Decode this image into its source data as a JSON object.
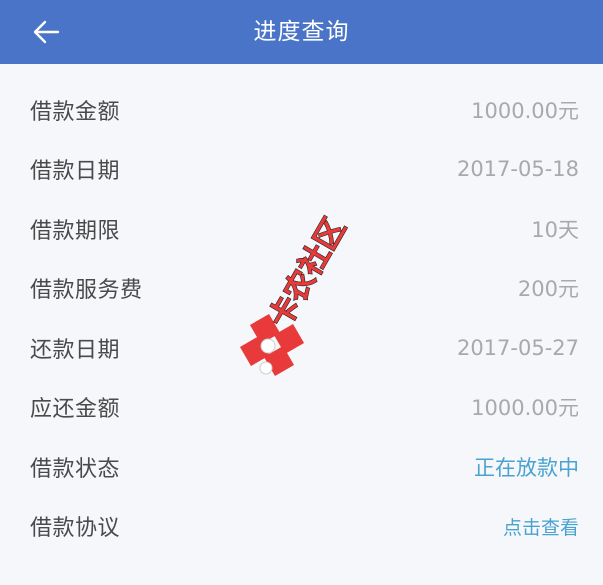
{
  "header": {
    "title": "进度查询",
    "back_icon": "arrow-left-icon"
  },
  "rows": [
    {
      "label": "借款金额",
      "value": "1000.00元"
    },
    {
      "label": "借款日期",
      "value": "2017-05-18"
    },
    {
      "label": "借款期限",
      "value": "10天"
    },
    {
      "label": "借款服务费",
      "value": "200元"
    },
    {
      "label": "还款日期",
      "value": "2017-05-27"
    },
    {
      "label": "应还金额",
      "value": "1000.00元"
    },
    {
      "label": "借款状态",
      "value": "正在放款中"
    },
    {
      "label": "借款协议",
      "value": "点击查看"
    }
  ],
  "watermark": {
    "text": "卡农社区"
  },
  "colors": {
    "header_bg": "#4a74c7",
    "accent": "#4aa3cf",
    "label": "#4a4a4a",
    "value": "#a9a9a9",
    "watermark_red": "#e83a3a"
  }
}
